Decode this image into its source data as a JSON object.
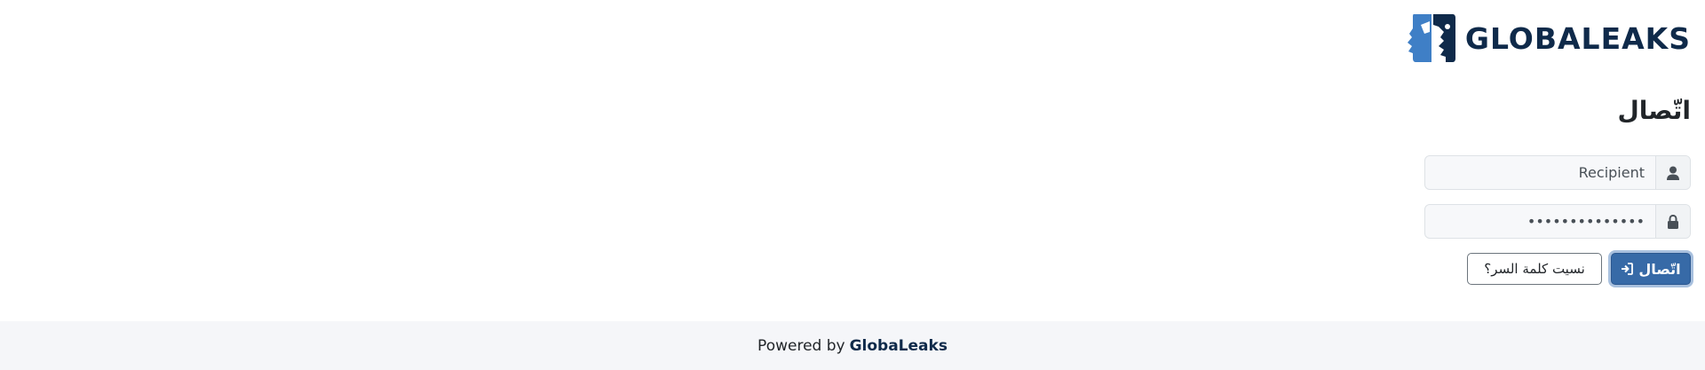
{
  "header": {
    "logo_text": "GLOBALEAKS",
    "logo_icon": "two-faces-whisper-logo"
  },
  "login": {
    "title": "اتّصال",
    "username": {
      "value": "Recipient",
      "icon": "user-icon"
    },
    "password": {
      "value": "••••••••••••••",
      "icon": "lock-icon"
    },
    "login_button_label": "اتّصال",
    "login_button_icon": "sign-in-icon",
    "forgot_password_label": "نسيت كلمة السر؟"
  },
  "footer": {
    "powered_by": "Powered by",
    "brand": "GlobaLeaks"
  },
  "colors": {
    "primary": "#376aa7",
    "brand_dark": "#0f2a4a",
    "brand_light": "#3f7fc6",
    "footer_bg": "#f5f6f9"
  }
}
